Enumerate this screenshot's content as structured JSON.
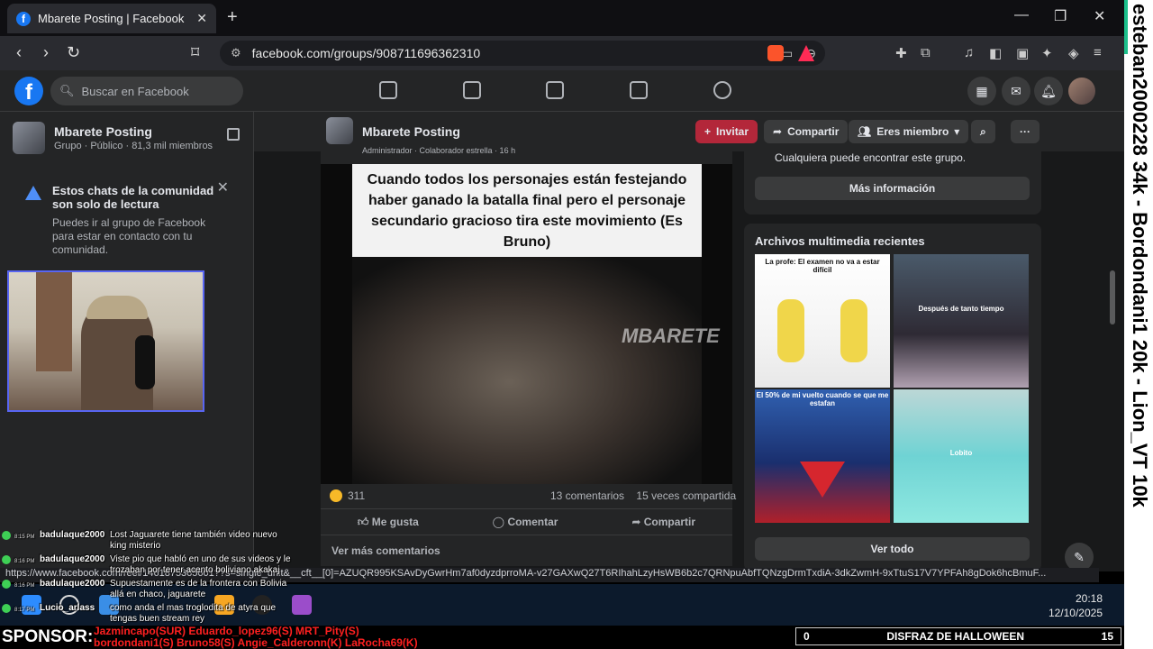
{
  "browser": {
    "tab_title": "Mbarete Posting | Facebook",
    "url": "facebook.com/groups/908711696362310",
    "badge_count": "4",
    "status_url": "https://www.facebook.com/reel/1461875365601??s=single_unit&__cft__[0]=AZUQR995KSAvDyGwrHm7af0dyzdprroMA-v27GAXwQ27T6RIhahLzyHsWB6b2c7QRNpuAbfTQNzgDrmTxdiA-3dkZwmH-9xTtuS17V7YPFAh8gDok6hcBmuF..."
  },
  "facebook": {
    "search_placeholder": "Buscar en Facebook",
    "group": {
      "name": "Mbarete Posting",
      "meta": "Grupo · Público · 81,3 mil miembros"
    },
    "notice": {
      "title": "Estos chats de la comunidad son solo de lectura",
      "body": "Puedes ir al grupo de Facebook para estar en contacto con tu comunidad."
    },
    "header_buttons": {
      "invite": "Invitar",
      "share": "Compartir",
      "member": "Eres miembro"
    },
    "post": {
      "author_line": "Administrador · Colaborador estrella · 16 h",
      "caption": "Cuando todos los personajes están festejando haber ganado la batalla final pero el personaje secundario gracioso tira este movimiento (Es Bruno)",
      "watermark": "MBARETE",
      "reactions": "311",
      "comments": "13 comentarios",
      "shares": "15 veces compartida",
      "like": "Me gusta",
      "comment": "Comentar",
      "share": "Compartir",
      "more_comments": "Ver más comentarios"
    },
    "about": {
      "text": "Cualquiera puede encontrar este grupo.",
      "button": "Más información"
    },
    "media": {
      "title": "Archivos multimedia recientes",
      "items": [
        {
          "label": "La profe: El examen no va a estar difícil"
        },
        {
          "label": "Después de tanto tiempo"
        },
        {
          "label": "El 50% de mi vuelto cuando se que me estafan"
        },
        {
          "label": "Lobito"
        }
      ],
      "see_all": "Ver todo"
    }
  },
  "chat": [
    {
      "time": "8:15 PM",
      "user": "badulaque2000",
      "text": "Lost Jaguarete tiene también video nuevo king misterio"
    },
    {
      "time": "8:16 PM",
      "user": "badulaque2000",
      "text": "Viste pio que habló en uno de sus videos y le trozaban por tener acento boliviano akakaj"
    },
    {
      "time": "8:16 PM",
      "user": "badulaque2000",
      "text": "Supuestamente es de la frontera con Bolivia allá en chaco, jaguarete"
    },
    {
      "time": "8:17 PM",
      "user": "Lucio_arlass",
      "text": "como anda el mas troglodita de atyra que tengas buen stream rey"
    }
  ],
  "taskbar": {
    "time": "20:18",
    "date": "12/10/2025"
  },
  "overlay": {
    "sponsor_label": "SPONSOR:",
    "sponsor_line1": "Jazmincapo(SUR) Eduardo_lopez96(S) MRT_Pity(S)",
    "sponsor_line2": "bordondani1(S) Bruno58(S) Angie_Calderonn(K) LaRocha69(K)",
    "counter_left": "0",
    "counter_title": "DISFRAZ DE HALLOWEEN",
    "counter_right": "15",
    "ticker": "esteban2000228 34k - Bordondani1 20k - Lion_VT 10k"
  }
}
